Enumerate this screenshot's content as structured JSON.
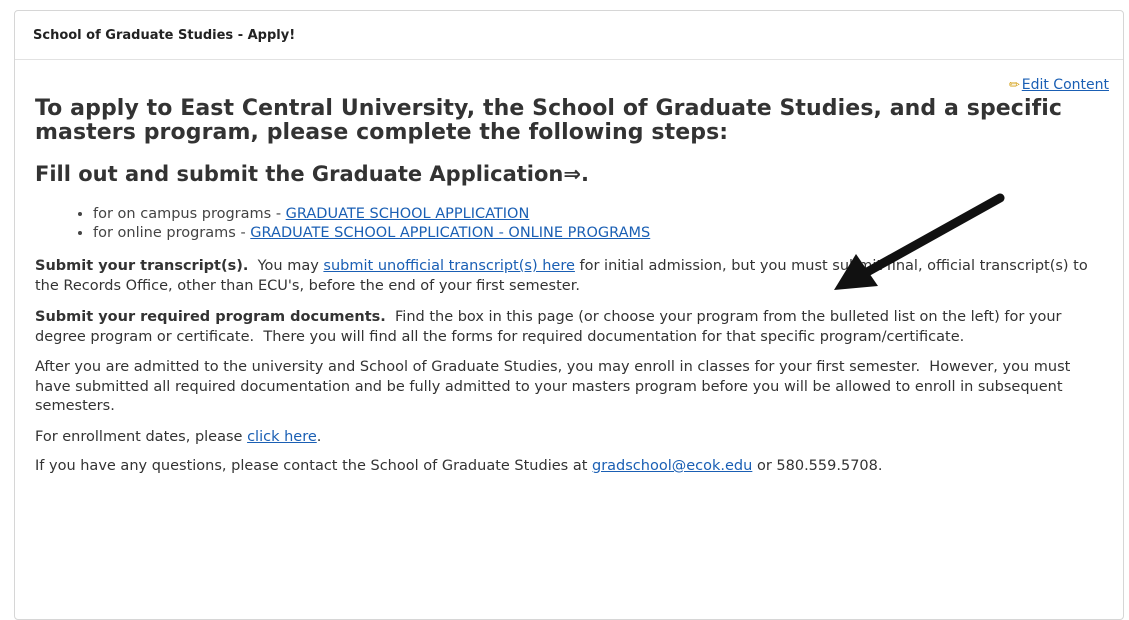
{
  "panel": {
    "heading": "School of Graduate Studies - Apply!"
  },
  "edit": {
    "label": "Edit Content",
    "icon": "pencil-icon"
  },
  "intro": {
    "title": "To apply to East Central University, the School of Graduate Studies, and a specific masters program, please complete the following steps:",
    "step1": "Fill out and submit the Graduate Application⇒."
  },
  "applications": [
    {
      "prefix": "for on campus programs - ",
      "link": "GRADUATE SCHOOL APPLICATION"
    },
    {
      "prefix": "for online programs - ",
      "link": "GRADUATE SCHOOL APPLICATION - ONLINE PROGRAMS"
    }
  ],
  "transcripts": {
    "bold": "Submit your transcript(s).",
    "pre": "  You may ",
    "link": "submit unofficial transcript(s) here",
    "post": " for initial admission, but you must submit final, official transcript(s) to the Records Office, other than ECU's, before the end of your first semester."
  },
  "documents": {
    "bold": "Submit your required program documents.",
    "text": "  Find the box in this page (or choose your program from the bulleted list on the left) for your degree program or certificate.  There you will find all the forms for required documentation for that specific program/certificate."
  },
  "admitted": {
    "text": "After you are admitted to the university and School of Graduate Studies, you may enroll in classes for your first semester.  However, you must have submitted all required documentation and be fully admitted to your masters program before you will be allowed to enroll in subsequent semesters."
  },
  "enrollment": {
    "pre": "For enrollment dates, please ",
    "link": "click here",
    "post": "."
  },
  "contact": {
    "pre": "If you have any questions, please contact the School of Graduate Studies at ",
    "email": "gradschool@ecok.edu",
    "post": " or 580.559.5708."
  },
  "colors": {
    "link": "#1a5fb4",
    "text": "#333333",
    "arrow": "#111111"
  }
}
